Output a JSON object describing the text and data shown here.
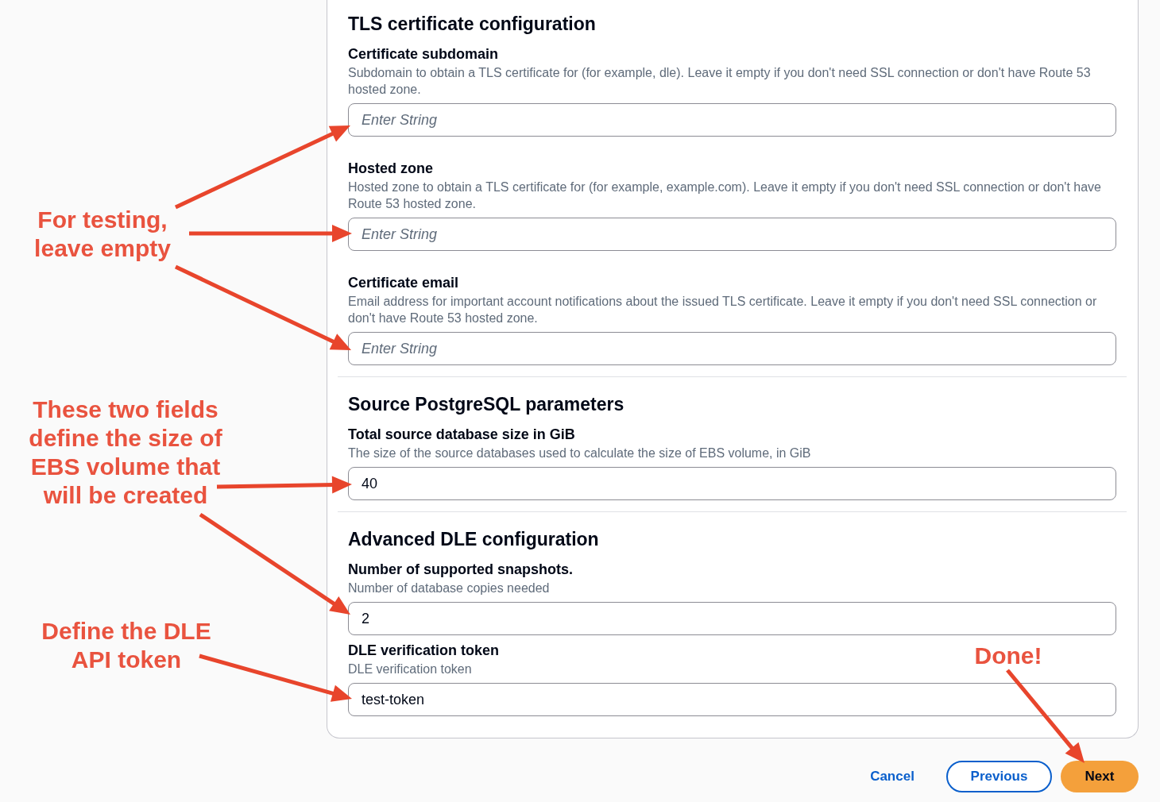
{
  "sections": [
    {
      "title": "TLS certificate configuration",
      "fields": [
        {
          "label": "Certificate subdomain",
          "description": "Subdomain to obtain a TLS certificate for (for example, dle). Leave it empty if you don't need SSL connection or don't have Route 53 hosted zone.",
          "placeholder": "Enter String"
        },
        {
          "label": "Hosted zone",
          "description": "Hosted zone to obtain a TLS certificate for (for example, example.com). Leave it empty if you don't need SSL connection or don't have Route 53 hosted zone.",
          "placeholder": "Enter String"
        },
        {
          "label": "Certificate email",
          "description": "Email address for important account notifications about the issued TLS certificate. Leave it empty if you don't need SSL connection or don't have Route 53 hosted zone.",
          "placeholder": "Enter String"
        }
      ]
    },
    {
      "title": "Source PostgreSQL parameters",
      "fields": [
        {
          "label": "Total source database size in GiB",
          "description": "The size of the source databases used to calculate the size of EBS volume, in GiB",
          "value": "40"
        }
      ]
    },
    {
      "title": "Advanced DLE configuration",
      "fields": [
        {
          "label": "Number of supported snapshots.",
          "description": "Number of database copies needed",
          "value": "2"
        },
        {
          "label": "DLE verification token",
          "description": "DLE verification token",
          "value": "test-token"
        }
      ]
    }
  ],
  "actions": [
    {
      "label": "Cancel",
      "kind": "link"
    },
    {
      "label": "Previous",
      "kind": "secondary"
    },
    {
      "label": "Next",
      "kind": "primary"
    }
  ],
  "annotations": [
    {
      "lines": [
        "For testing,",
        "leave empty"
      ]
    },
    {
      "lines": [
        "These two fields",
        "define the size of",
        "EBS volume that",
        "will be created"
      ]
    },
    {
      "lines": [
        "Define the DLE",
        "API token"
      ]
    },
    {
      "lines": [
        "Done!"
      ]
    }
  ]
}
